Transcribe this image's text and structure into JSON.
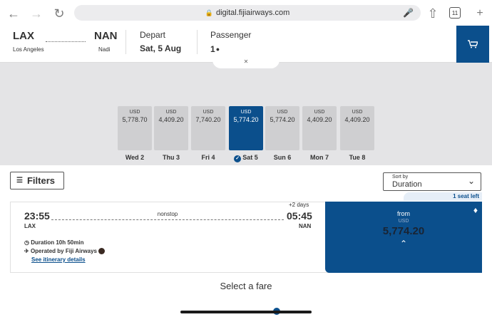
{
  "browser": {
    "url": "digital.fijiairways.com",
    "tab_count": "11"
  },
  "header": {
    "origin_code": "LAX",
    "origin_city": "Los Angeles",
    "dest_code": "NAN",
    "dest_city": "Nadi",
    "depart_label": "Depart",
    "depart_date": "Sat, 5 Aug",
    "passenger_label": "Passenger",
    "passenger_count": "1"
  },
  "calendar": {
    "days": [
      {
        "currency": "USD",
        "price": "5,778.70",
        "label": "Wed 2",
        "selected": false
      },
      {
        "currency": "USD",
        "price": "4,409.20",
        "label": "Thu 3",
        "selected": false
      },
      {
        "currency": "USD",
        "price": "7,740.20",
        "label": "Fri 4",
        "selected": false
      },
      {
        "currency": "USD",
        "price": "5,774.20",
        "label": "Sat 5",
        "selected": true
      },
      {
        "currency": "USD",
        "price": "5,774.20",
        "label": "Sun 6",
        "selected": false
      },
      {
        "currency": "USD",
        "price": "4,409.20",
        "label": "Mon 7",
        "selected": false
      },
      {
        "currency": "USD",
        "price": "4,409.20",
        "label": "Tue 8",
        "selected": false
      }
    ]
  },
  "filters": {
    "label": "Filters"
  },
  "sort": {
    "small_label": "Sort by",
    "value": "Duration"
  },
  "flight": {
    "seats_left": "1 seat left",
    "dep_time": "23:55",
    "dep_code": "LAX",
    "arr_time": "05:45",
    "arr_code": "NAN",
    "stops": "nonstop",
    "day_offset": "+2 days",
    "duration": "Duration 10h 50min",
    "operated_by": "Operated by Fiji Airways",
    "itinerary_link": "See itinerary details",
    "fare_from": "from",
    "fare_currency": "USD",
    "fare_amount": "5,774.20"
  },
  "footer": {
    "select_fare": "Select a fare"
  },
  "colors": {
    "brand_blue": "#0b4f8c",
    "calendar_bg": "#e4e4e6"
  }
}
